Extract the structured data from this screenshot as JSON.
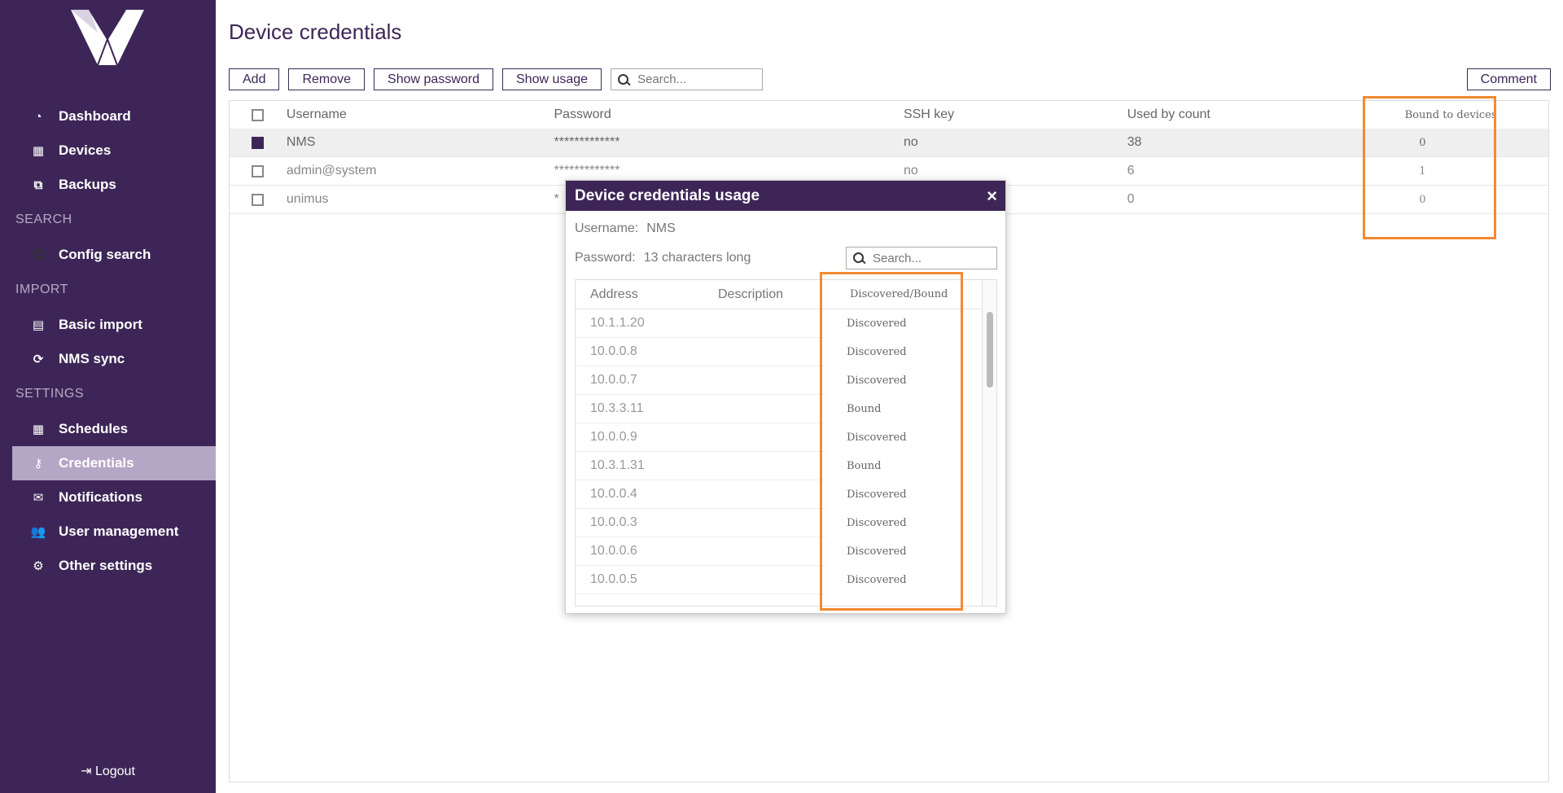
{
  "sidebar": {
    "items": [
      {
        "label": "Dashboard",
        "icon": "dashboard-icon"
      },
      {
        "label": "Devices",
        "icon": "devices-icon"
      },
      {
        "label": "Backups",
        "icon": "backups-icon"
      }
    ],
    "section_search": "SEARCH",
    "search_items": [
      {
        "label": "Config search",
        "icon": "search-icon"
      }
    ],
    "section_import": "IMPORT",
    "import_items": [
      {
        "label": "Basic import",
        "icon": "file-icon"
      },
      {
        "label": "NMS sync",
        "icon": "sync-icon"
      }
    ],
    "section_settings": "SETTINGS",
    "settings_items": [
      {
        "label": "Schedules",
        "icon": "calendar-icon"
      },
      {
        "label": "Credentials",
        "icon": "key-icon"
      },
      {
        "label": "Notifications",
        "icon": "envelope-icon"
      },
      {
        "label": "User management",
        "icon": "users-icon"
      },
      {
        "label": "Other settings",
        "icon": "gears-icon"
      }
    ],
    "logout": "Logout"
  },
  "page": {
    "title": "Device credentials"
  },
  "toolbar": {
    "add": "Add",
    "remove": "Remove",
    "show_password": "Show password",
    "show_usage": "Show usage",
    "search_placeholder": "Search...",
    "comment": "Comment"
  },
  "table": {
    "headers": [
      "Username",
      "Password",
      "SSH key",
      "Used by count",
      "Bound to devices"
    ],
    "rows": [
      {
        "username": "NMS",
        "password": "*************",
        "ssh": "no",
        "used": "38",
        "bound": "0",
        "selected": true
      },
      {
        "username": "admin@system",
        "password": "*************",
        "ssh": "no",
        "used": "6",
        "bound": "1",
        "selected": false
      },
      {
        "username": "unimus",
        "password": "*",
        "ssh": "",
        "used": "0",
        "bound": "0",
        "selected": false
      }
    ]
  },
  "dialog": {
    "title": "Device credentials usage",
    "close": "×",
    "username_label": "Username:",
    "username_value": "NMS",
    "password_label": "Password:",
    "password_value": "13 characters long",
    "search_placeholder": "Search...",
    "headers": [
      "Address",
      "Description",
      "Discovered/Bound"
    ],
    "rows": [
      {
        "address": "10.1.1.20",
        "description": "",
        "status": "Discovered"
      },
      {
        "address": "10.0.0.8",
        "description": "",
        "status": "Discovered"
      },
      {
        "address": "10.0.0.7",
        "description": "",
        "status": "Discovered"
      },
      {
        "address": "10.3.3.11",
        "description": "",
        "status": "Bound"
      },
      {
        "address": "10.0.0.9",
        "description": "",
        "status": "Discovered"
      },
      {
        "address": "10.3.1.31",
        "description": "",
        "status": "Bound"
      },
      {
        "address": "10.0.0.4",
        "description": "",
        "status": "Discovered"
      },
      {
        "address": "10.0.0.3",
        "description": "",
        "status": "Discovered"
      },
      {
        "address": "10.0.0.6",
        "description": "",
        "status": "Discovered"
      },
      {
        "address": "10.0.0.5",
        "description": "",
        "status": "Discovered"
      }
    ]
  },
  "colors": {
    "brand": "#3d2657",
    "highlight": "#f28a30",
    "active_nav": "#b4a6c5"
  }
}
